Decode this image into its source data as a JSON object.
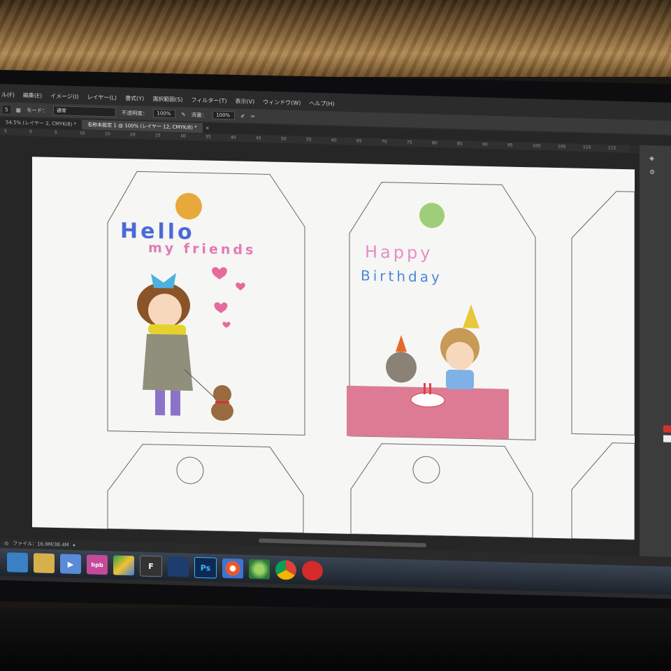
{
  "menu": {
    "items": [
      "ル(F)",
      "編集(E)",
      "イメージ(I)",
      "レイヤー(L)",
      "書式(Y)",
      "選択範囲(S)",
      "フィルター(T)",
      "表示(V)",
      "ウィンドウ(W)",
      "ヘルプ(H)"
    ]
  },
  "options": {
    "mode_label": "モード：",
    "mode_value": "通常",
    "opacity_label": "不透明度：",
    "opacity_value": "100%",
    "flow_label": "流量：",
    "flow_value": "100%"
  },
  "tabs": [
    {
      "label": "54.5% (レイヤー 2, CMYK/8) *"
    },
    {
      "label": "名称未設定 1 @ 100% (レイヤー 12, CMYK/8) *"
    }
  ],
  "ruler": [
    "5",
    "0",
    "5",
    "10",
    "15",
    "20",
    "25",
    "30",
    "35",
    "40",
    "45",
    "50",
    "55",
    "60",
    "65",
    "70",
    "75",
    "80",
    "85",
    "90",
    "95",
    "100",
    "105",
    "110",
    "115"
  ],
  "status": {
    "file_label": "ファイル：16.9M/38.4M"
  },
  "cards": {
    "card1_line1": "Hello",
    "card1_line2": "my friends",
    "card2_line1": "Happy",
    "card2_line2": "Birthday"
  },
  "taskbar": {
    "items": [
      "explorer-icon",
      "folder-icon",
      "media-icon",
      "hpb-icon",
      "drive-icon",
      "f-app-icon",
      "ink-icon",
      "photoshop-icon",
      "chromium-icon",
      "maps-icon",
      "chrome-icon",
      "security-icon"
    ],
    "labels": [
      "",
      "",
      "▶",
      "hpb",
      "",
      "F",
      "",
      "Ps",
      "",
      "",
      "",
      ""
    ]
  },
  "colors": {
    "dot_orange": "#e8a93a",
    "dot_green": "#9fce7a",
    "table_pink": "#dd7b94",
    "swatch_red": "#d83030"
  }
}
